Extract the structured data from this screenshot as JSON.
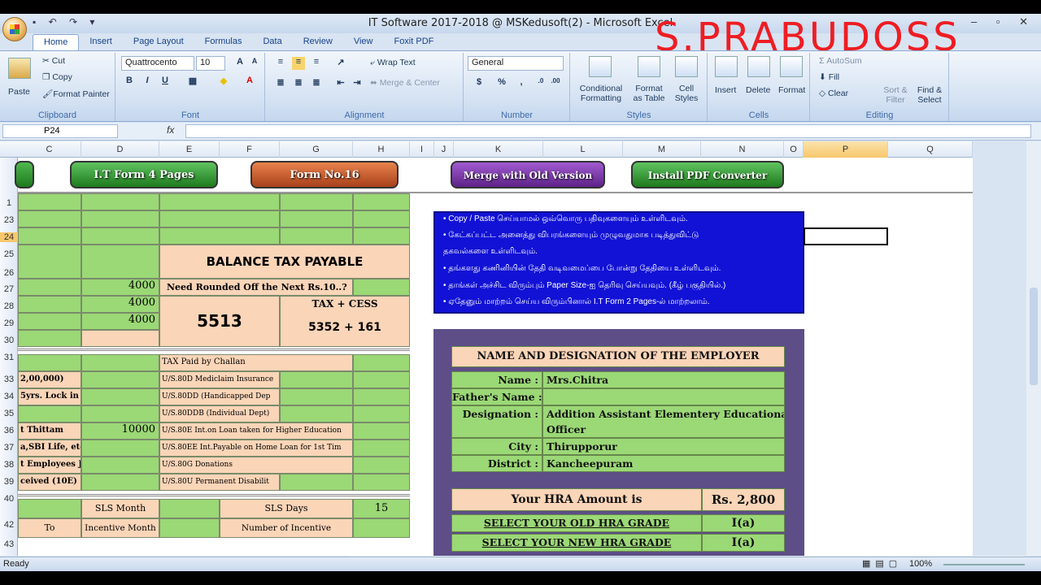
{
  "window": {
    "title": "IT Software 2017-2018 @ MSKedusoft(2) - Microsoft Excel",
    "controls": "– ▫ ✕"
  },
  "watermark": "S.PRABUDOSS",
  "tabs": [
    "Home",
    "Insert",
    "Page Layout",
    "Formulas",
    "Data",
    "Review",
    "View",
    "Foxit PDF"
  ],
  "ribbon": {
    "clipboard": {
      "label": "Clipboard",
      "paste": "Paste",
      "cut": "Cut",
      "copy": "Copy",
      "painter": "Format Painter"
    },
    "font": {
      "label": "Font",
      "name": "Quattrocento",
      "size": "10",
      "bold": "B",
      "italic": "I",
      "underline": "U"
    },
    "alignment": {
      "label": "Alignment",
      "wrap": "Wrap Text",
      "merge": "Merge & Center"
    },
    "number": {
      "label": "Number",
      "format": "General",
      "pct": "%"
    },
    "styles": {
      "label": "Styles",
      "cond": "Conditional Formatting",
      "fmt_table": "Format as Table",
      "cell_styles": "Cell Styles"
    },
    "cells": {
      "label": "Cells",
      "insert": "Insert",
      "delete": "Delete",
      "format": "Format"
    },
    "editing": {
      "label": "Editing",
      "autosum": "AutoSum",
      "fill": "Fill",
      "clear": "Clear",
      "sort": "Sort & Filter",
      "find": "Find & Select"
    }
  },
  "formula_bar": {
    "name_box": "P24",
    "fx": "fx",
    "value": ""
  },
  "columns": [
    "C",
    "D",
    "E",
    "F",
    "G",
    "H",
    "I",
    "J",
    "K",
    "L",
    "M",
    "N",
    "O",
    "P",
    "Q"
  ],
  "rows": [
    "1",
    "23",
    "24",
    "25",
    "26",
    "27",
    "28",
    "29",
    "30",
    "31",
    "33",
    "34",
    "35",
    "36",
    "37",
    "38",
    "39",
    "40",
    "42",
    "43"
  ],
  "buttons": {
    "it_form": "I.T Form 4 Pages",
    "form16": "Form No.16",
    "merge_old": "Merge with Old Version",
    "install_pdf": "Install PDF Converter"
  },
  "left": {
    "balance": "BALANCE TAX PAYABLE",
    "rounded": "Need Rounded Off the Next Rs.10..?",
    "d28": "4000",
    "d29": "4000",
    "d30": "4000",
    "tax_total": "5513",
    "tax_cess_label": "TAX + CESS",
    "tax_cess_value": "5352 + 161",
    "r33": "TAX Paid by Challan",
    "c34": "2,00,000)",
    "e34": "U/S.80D Mediclaim Insurance",
    "c35": "5yrs. Lock in F",
    "e35": "U/S.80DD (Handicapped Dep",
    "e36": "U/S.80DDB (Individual Dept)",
    "c37": "t Thittam",
    "d37": "10000",
    "e37": "U/S.80E Int.on Loan taken for Higher Education",
    "c38": "a,SBI Life, etc.,",
    "e38": "U/S.80EE Int.Payable on Home Loan for 1st Tim",
    "c39": "t Employees Joi",
    "e39": "U/S.80G Donations",
    "c40": "ceived (10E)",
    "e40": "U/S.80U Permanent Disabilit",
    "d42": "SLS Month",
    "f42": "SLS Days",
    "h42": "15",
    "c43": "To",
    "d43": "Incentive Month",
    "f43": "Number of Incentive"
  },
  "instructions": [
    "• Copy / Paste செய்யாமல் ஒவ்வொரு பதிவுகளையும் உள்ளிடவும்.",
    "• கேட்கப்பட்ட அனைத்து விபரங்களையும் முழுவதுமாக படித்துவிட்டு",
    "   தகவல்களை உள்ளிடவும்.",
    "• தங்களது கணினியின் தேதி வடிவமைப்பை போன்று தேதியை உள்ளிடவும்.",
    "• தாங்கள் அச்சிட விரும்பும் Paper Size-ஐ தெரிவு செய்யவும். (கீழ் பகுதியில்.)",
    "• ஏதேனும் மாற்றம் செய்ய விரும்பினால் I.T Form 2 Pages-ல் மாற்றலாம்."
  ],
  "employer": {
    "title": "NAME AND DESIGNATION OF THE EMPLOYER",
    "name_label": "Name :",
    "name": "Mrs.Chitra",
    "father_label": "Father's Name :",
    "father": "",
    "desig_label": "Designation :",
    "desig1": "Addition Assistant Elementery Educational",
    "desig2": "Officer",
    "city_label": "City :",
    "city": "Thirupporur",
    "district_label": "District :",
    "district": "Kancheepuram"
  },
  "hra": {
    "label": "Your HRA Amount is",
    "amount": "Rs. 2,800",
    "old_label": "SELECT YOUR OLD HRA GRADE",
    "old": "I(a)",
    "new_label": "SELECT YOUR NEW HRA GRADE",
    "new": "I(a)"
  },
  "status": {
    "ready": "Ready",
    "zoom": "100%"
  },
  "colors": {
    "green": "#9bd876",
    "peach": "#fad5b8",
    "blue": "#1212d6",
    "purple": "#5d4e87"
  }
}
